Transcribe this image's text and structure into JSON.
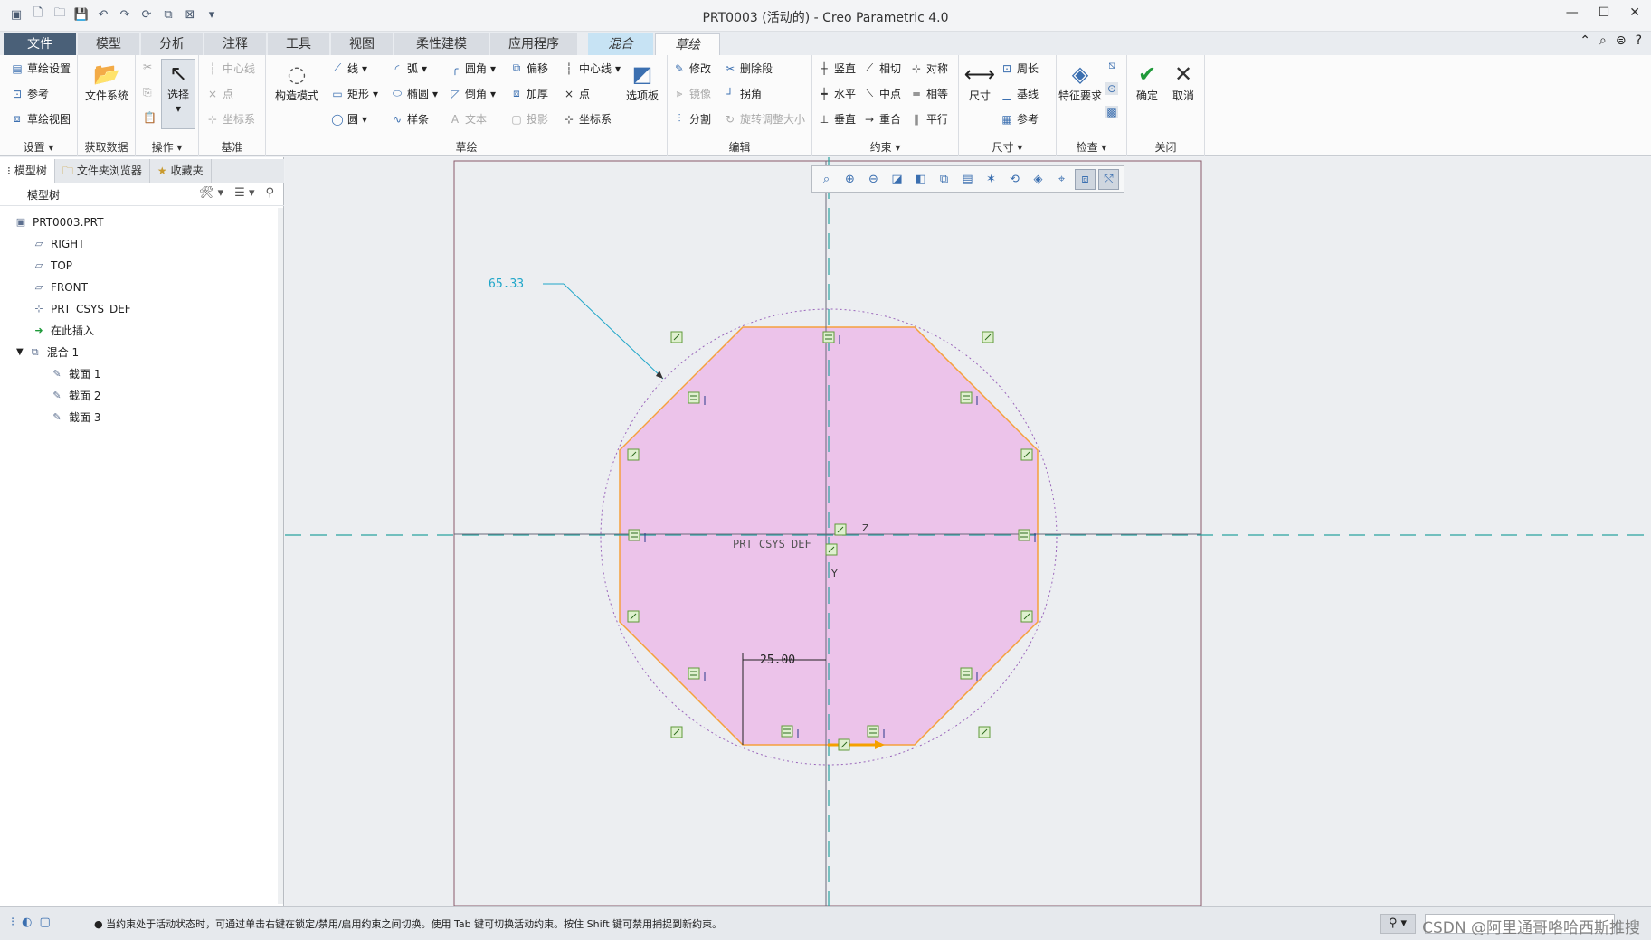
{
  "window": {
    "title": "PRT0003 (活动的) - Creo Parametric 4.0"
  },
  "tabs": [
    {
      "label": "文件"
    },
    {
      "label": "模型"
    },
    {
      "label": "分析"
    },
    {
      "label": "注释"
    },
    {
      "label": "工具"
    },
    {
      "label": "视图"
    },
    {
      "label": "柔性建模"
    },
    {
      "label": "应用程序"
    },
    {
      "label": "混合"
    },
    {
      "label": "草绘"
    }
  ],
  "ribbon": {
    "settings": {
      "title": "设置",
      "sketch_setup": "草绘设置",
      "reference": "参考",
      "sketch_view": "草绘视图"
    },
    "get_data": {
      "title": "获取数据",
      "file_system": "文件系统"
    },
    "operations": {
      "title": "操作",
      "select": "选择"
    },
    "datum": {
      "title": "基准",
      "centerline": "中心线",
      "point": "点",
      "csys": "坐标系"
    },
    "sketch": {
      "title": "草绘",
      "construction": "构造模式",
      "line": "线",
      "rectangle": "矩形",
      "circle": "圆",
      "arc": "弧",
      "ellipse": "椭圆",
      "spline": "样条",
      "fillet": "圆角",
      "chamfer": "倒角",
      "text": "文本",
      "offset": "偏移",
      "thicken": "加厚",
      "project": "投影",
      "centerline": "中心线",
      "point": "点",
      "csys": "坐标系",
      "palette": "选项板"
    },
    "edit": {
      "title": "编辑",
      "modify": "修改",
      "delete_segment": "删除段",
      "mirror": "镜像",
      "corner": "拐角",
      "divide": "分割",
      "rotate_resize": "旋转调整大小"
    },
    "constrain": {
      "title": "约束",
      "vertical": "竖直",
      "tangent": "相切",
      "symmetric": "对称",
      "horizontal": "水平",
      "midpoint": "中点",
      "equal": "相等",
      "perpendicular": "垂直",
      "coincident": "重合",
      "parallel": "平行"
    },
    "dimension": {
      "title": "尺寸",
      "dimension": "尺寸",
      "perimeter": "周长",
      "baseline": "基线",
      "reference": "参考"
    },
    "inspect": {
      "title": "检查",
      "feature_req": "特征要求"
    },
    "close": {
      "title": "关闭",
      "ok": "确定",
      "cancel": "取消"
    }
  },
  "sidebar": {
    "tabs": [
      {
        "label": "模型树"
      },
      {
        "label": "文件夹浏览器"
      },
      {
        "label": "收藏夹"
      }
    ],
    "tree_header": "模型树",
    "tree": [
      {
        "label": "PRT0003.PRT"
      },
      {
        "label": "RIGHT"
      },
      {
        "label": "TOP"
      },
      {
        "label": "FRONT"
      },
      {
        "label": "PRT_CSYS_DEF"
      },
      {
        "label": "在此插入"
      },
      {
        "label": "混合 1"
      },
      {
        "label": "截面 1"
      },
      {
        "label": "截面 2"
      },
      {
        "label": "截面 3"
      }
    ]
  },
  "canvas": {
    "dim_diameter": "65.33",
    "dim_side": "25.00",
    "csys_label": "PRT_CSYS_DEF",
    "axis_z": "Z",
    "axis_y": "Y",
    "fill_color": "#ecc3ea",
    "outline_color": "#f5a03c",
    "dim_color": "#1fa6c9"
  },
  "status": {
    "message": "当约束处于活动状态时，可通过单击右键在锁定/禁用/启用约束之间切换。使用 Tab 键可切换活动约束。按住 Shift 键可禁用捕捉到新约束。",
    "watermark": "CSDN @阿里通哥咯哈西斯推搜"
  }
}
